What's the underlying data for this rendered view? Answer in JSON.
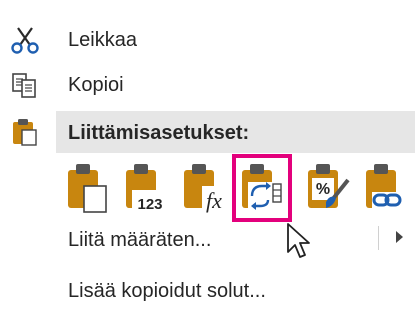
{
  "menu": {
    "cut": {
      "label": "Leikkaa",
      "icon": "scissors-icon"
    },
    "copy": {
      "label": "Kopioi",
      "icon": "copy-icon"
    },
    "paste_options_header": {
      "label": "Liittämisasetukset:",
      "icon": "paste-icon"
    },
    "paste_options": [
      {
        "name": "paste-default",
        "icon": "paste-icon"
      },
      {
        "name": "paste-values",
        "icon": "paste-values-icon",
        "badge": "123"
      },
      {
        "name": "paste-formulas",
        "icon": "paste-formulas-icon",
        "badge": "fx"
      },
      {
        "name": "paste-transpose",
        "icon": "paste-transpose-icon",
        "highlighted": true
      },
      {
        "name": "paste-formatting",
        "icon": "paste-formatting-icon",
        "badge": "%"
      },
      {
        "name": "paste-link",
        "icon": "paste-link-icon"
      }
    ],
    "paste_special": {
      "label": "Liitä määräten..."
    },
    "insert_copied": {
      "label": "Lisää kopioidut solut..."
    }
  },
  "colors": {
    "highlight": "#e3007c",
    "clipboard": "#c8860f",
    "header_bg": "#e6e6e6",
    "blue": "#1f5fb0"
  }
}
